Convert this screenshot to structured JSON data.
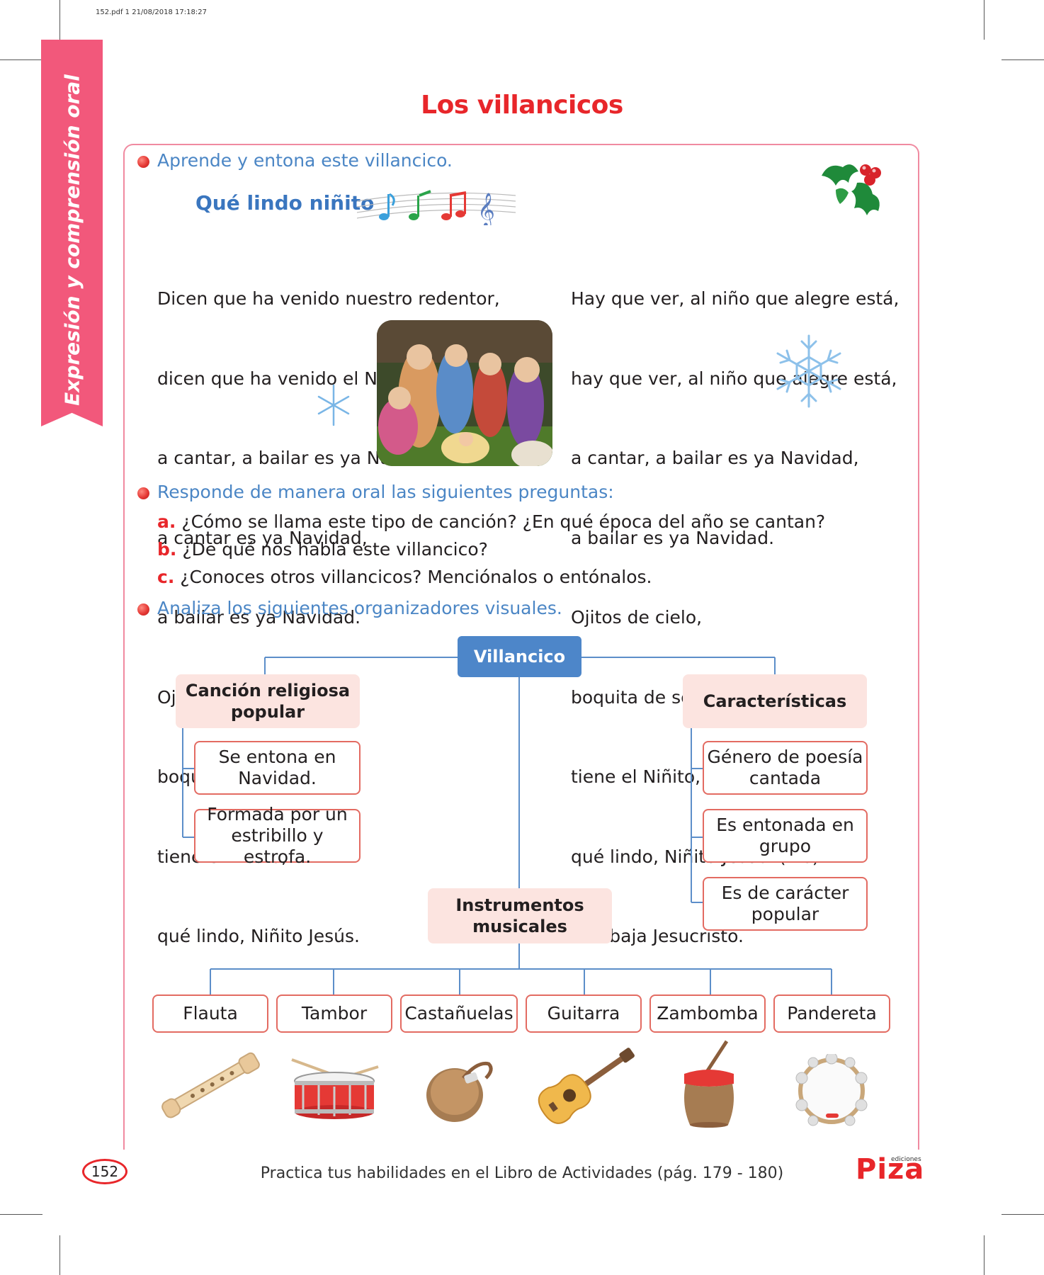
{
  "meta": {
    "file_info": "152.pdf  1  21/08/2018  17:18:27"
  },
  "side_tab": {
    "label": "Expresión y comprensión oral"
  },
  "title": "Los villancicos",
  "instructions": {
    "learn": "Aprende y entona este villancico.",
    "respond": "Responde de manera oral las siguientes preguntas:",
    "analyze": "Analiza los siguientes organizadores visuales."
  },
  "song": {
    "title": "Qué lindo niñito",
    "left_verse": [
      "Dicen que ha venido nuestro redentor,",
      "dicen que ha venido el Niño Jesús,",
      "a cantar, a bailar es ya Navidad,",
      "a cantar es ya Navidad,",
      "a bailar es ya Navidad.",
      "Ojitos de cielo,",
      "boquita de seda,",
      "tiene el Niñito,",
      "qué lindo, Niñito Jesús."
    ],
    "right_verse": [
      "Hay que ver, al niño que alegre está,",
      "hay que ver, al niño que alegre está,",
      "a cantar, a bailar es ya Navidad,",
      "a bailar es ya Navidad.",
      "Ojitos de cielo,",
      "boquita de seda,",
      "tiene el Niñito,",
      "qué lindo, Niñito Jesús. (Bis)",
      "Allá baja Jesucristo."
    ]
  },
  "questions": [
    {
      "letter": "a.",
      "text": "¿Cómo se llama este tipo de canción? ¿En qué época del año se cantan?"
    },
    {
      "letter": "b.",
      "text": "¿De qué nos habla este villancico?"
    },
    {
      "letter": "c.",
      "text": "¿Conoces otros villancicos? Menciónalos o entónalos."
    }
  ],
  "organizer": {
    "root": "Villancico",
    "left_title": "Canción religiosa popular",
    "left_items": [
      "Se entona en Navidad.",
      "Formada por un estribillo y estrofa."
    ],
    "right_title": "Características",
    "right_items": [
      "Género de poesía cantada",
      "Es entonada en grupo",
      "Es de carácter popular"
    ],
    "bottom_title": "Instrumentos musicales",
    "instruments": [
      "Flauta",
      "Tambor",
      "Castañuelas",
      "Guitarra",
      "Zambomba",
      "Pandereta"
    ]
  },
  "footer": {
    "page_number": "152",
    "practice": "Practica tus habilidades en el Libro de Actividades (pág. 179 - 180)",
    "logo": "Piza",
    "logo_small": "ediciones"
  },
  "icons": [
    "holly-icon",
    "music-notes-icon",
    "snowflake-icon",
    "nativity-image",
    "flute-icon",
    "drum-icon",
    "castanets-icon",
    "guitar-icon",
    "zambomba-icon",
    "tambourine-icon"
  ],
  "colors": {
    "accent_red": "#e8262a",
    "blue": "#4b86c5",
    "pink_tab": "#f2587b",
    "node_fill": "#fce4e0"
  }
}
